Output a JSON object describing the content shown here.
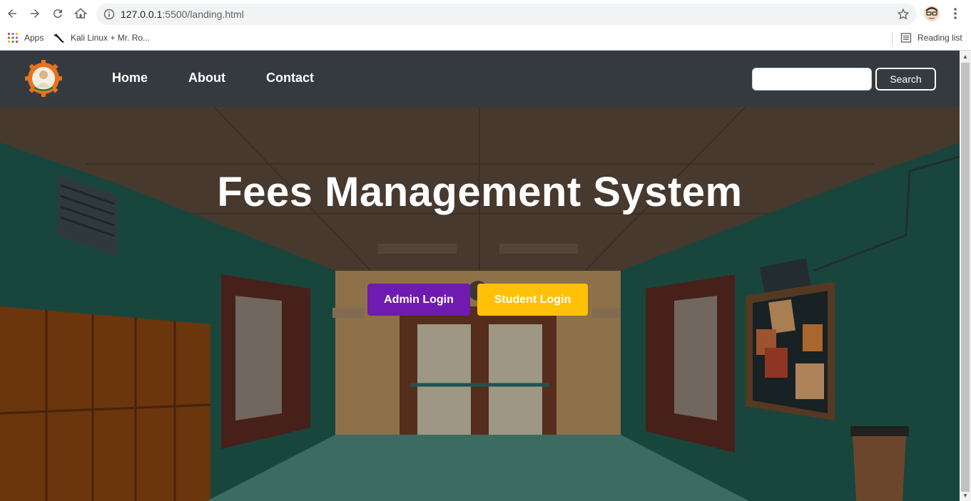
{
  "browser": {
    "url_host": "127.0.0.1",
    "url_rest": ":5500/landing.html",
    "bookmarks": [
      {
        "label": "Apps",
        "icon": "apps-grid-icon"
      },
      {
        "label": "Kali Linux + Mr. Ro...",
        "icon": "kali-dragon-icon"
      }
    ],
    "reading_list": "Reading list"
  },
  "navbar": {
    "links": [
      "Home",
      "About",
      "Contact"
    ],
    "search_placeholder": "",
    "search_button": "Search",
    "colors": {
      "background": "#343a40"
    }
  },
  "hero": {
    "title": "Fees Management System",
    "admin_button": "Admin Login",
    "student_button": "Student Login",
    "colors": {
      "admin": "#6f1ab1",
      "student": "#ffc107"
    }
  }
}
